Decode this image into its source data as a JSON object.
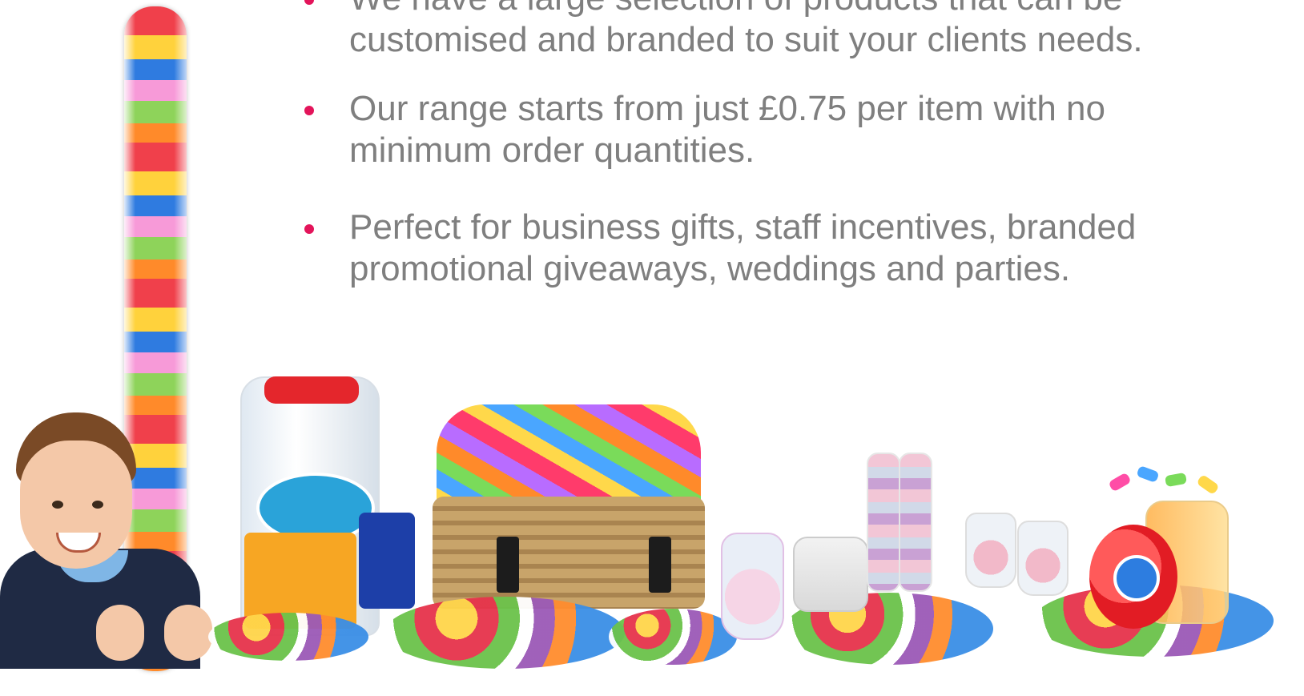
{
  "bullets": [
    {
      "text": "We have a large selection of products that can be customised and branded to suit your clients needs."
    },
    {
      "text": "Our range starts from just £0.75 per item with no minimum order quantities."
    },
    {
      "text": "Perfect for business gifts, staff incentives, branded promotional giveaways, weddings and parties."
    }
  ],
  "colors": {
    "bullet_dot": "#e3145a",
    "bullet_text": "#7f7f7f"
  },
  "collage": {
    "icon": "product-collage-image"
  }
}
